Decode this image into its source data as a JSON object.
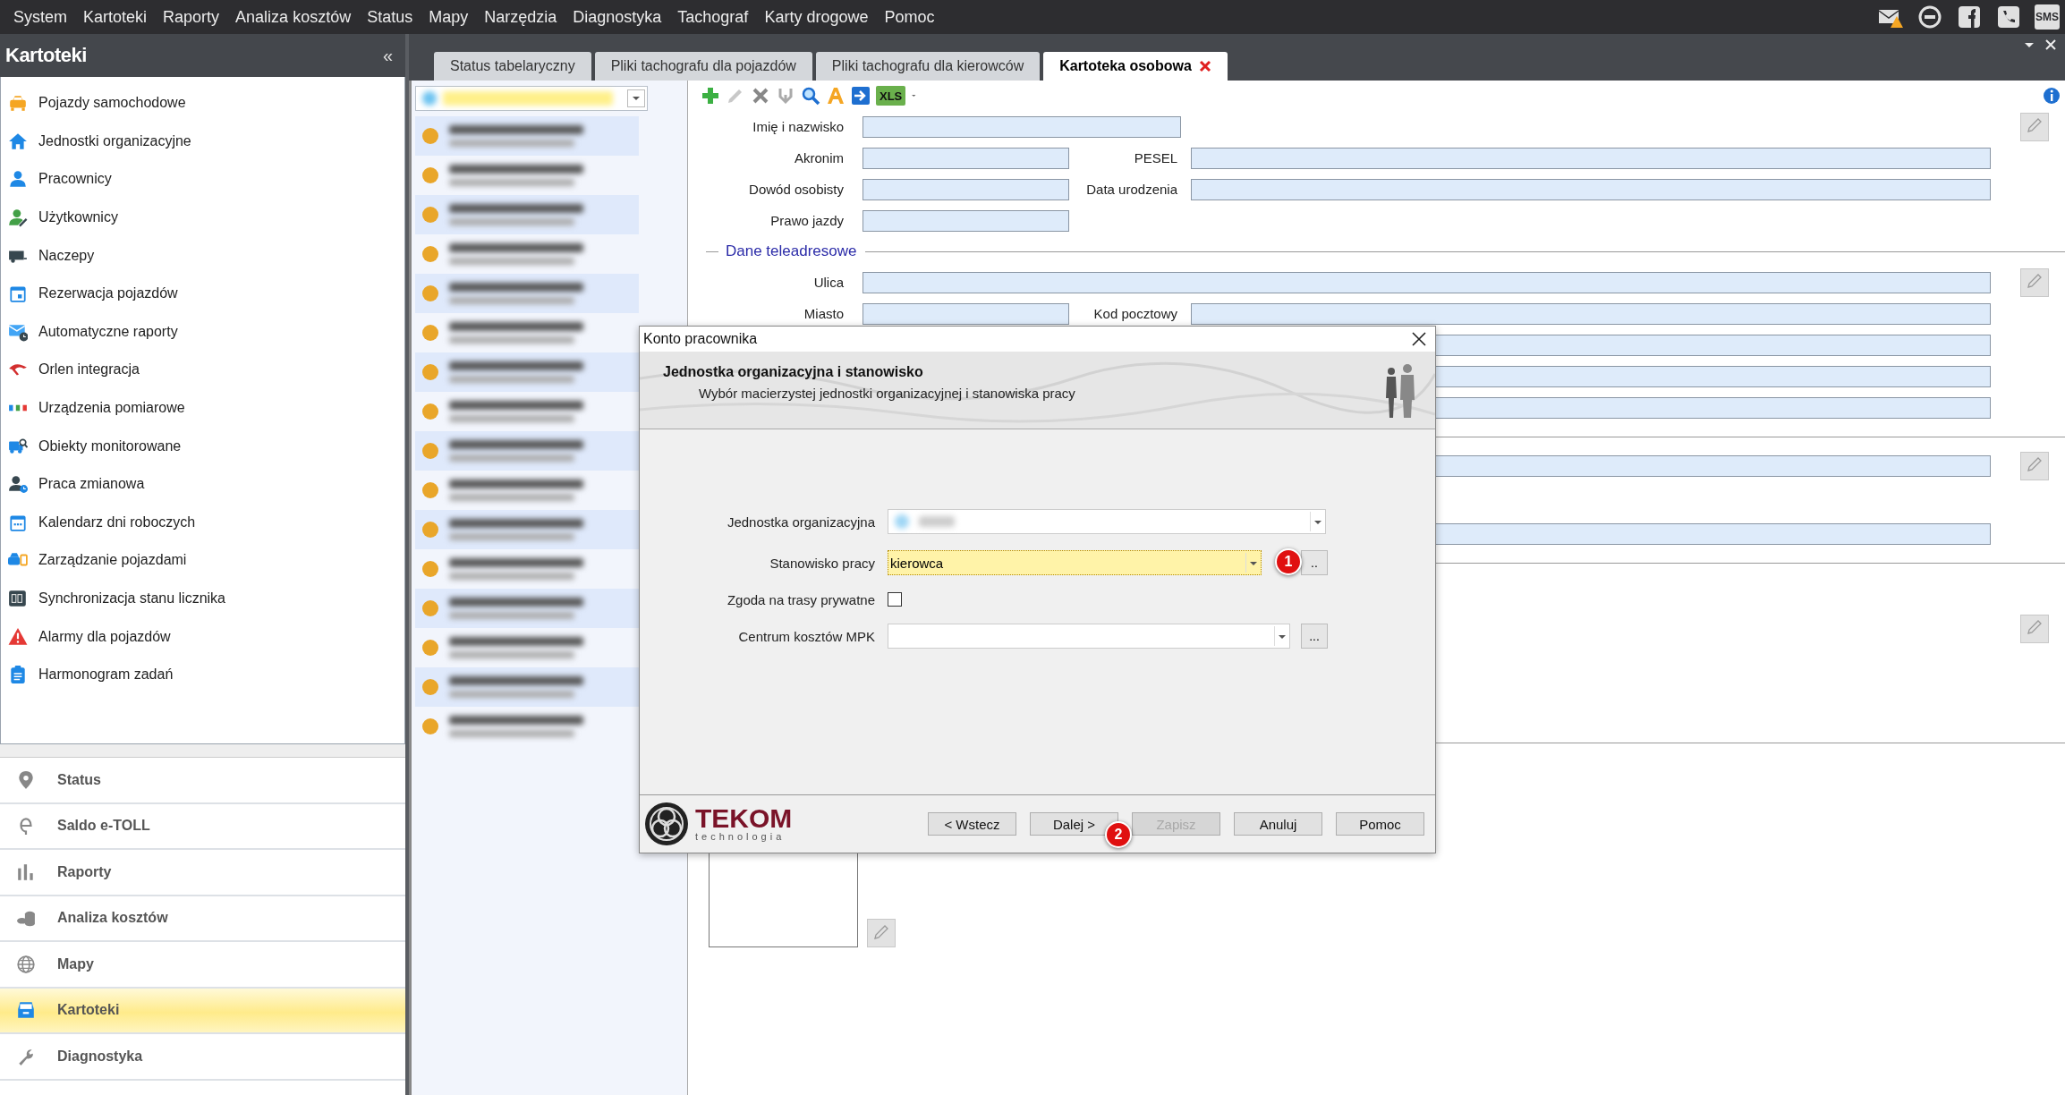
{
  "menu": [
    {
      "label": "System"
    },
    {
      "label": "Kartoteki"
    },
    {
      "label": "Raporty"
    },
    {
      "label": "Analiza kosztów"
    },
    {
      "label": "Status"
    },
    {
      "label": "Mapy"
    },
    {
      "label": "Narzędzia"
    },
    {
      "label": "Diagnostyka"
    },
    {
      "label": "Tachograf"
    },
    {
      "label": "Karty drogowe"
    },
    {
      "label": "Pomoc"
    }
  ],
  "top_icons": {
    "sms": "SMS"
  },
  "sidebar": {
    "title": "Kartoteki",
    "collapse": "«",
    "items": [
      {
        "label": "Pojazdy samochodowe"
      },
      {
        "label": "Jednostki organizacyjne"
      },
      {
        "label": "Pracownicy"
      },
      {
        "label": "Użytkownicy"
      },
      {
        "label": "Naczepy"
      },
      {
        "label": "Rezerwacja pojazdów"
      },
      {
        "label": "Automatyczne raporty"
      },
      {
        "label": "Orlen integracja"
      },
      {
        "label": "Urządzenia pomiarowe"
      },
      {
        "label": "Obiekty monitorowane"
      },
      {
        "label": "Praca zmianowa"
      },
      {
        "label": "Kalendarz dni roboczych"
      },
      {
        "label": "Zarządzanie pojazdami"
      },
      {
        "label": "Synchronizacja stanu licznika"
      },
      {
        "label": "Alarmy dla pojazdów"
      },
      {
        "label": "Harmonogram zadań"
      }
    ],
    "nav": [
      {
        "label": "Status",
        "selected": false
      },
      {
        "label": "Saldo e-TOLL",
        "selected": false
      },
      {
        "label": "Raporty",
        "selected": false
      },
      {
        "label": "Analiza kosztów",
        "selected": false
      },
      {
        "label": "Mapy",
        "selected": false
      },
      {
        "label": "Kartoteki",
        "selected": true
      },
      {
        "label": "Diagnostyka",
        "selected": false
      }
    ]
  },
  "tabs": [
    {
      "label": "Status tabelaryczny",
      "selected": false
    },
    {
      "label": "Pliki tachografu dla pojazdów",
      "selected": false
    },
    {
      "label": "Pliki tachografu dla kierowców",
      "selected": false
    },
    {
      "label": "Kartoteka osobowa",
      "selected": true
    }
  ],
  "list": {
    "rows": [
      {
        "kind": "redacted"
      },
      {
        "kind": "redacted"
      },
      {
        "kind": "redacted"
      },
      {
        "kind": "redacted"
      },
      {
        "kind": "redacted"
      },
      {
        "kind": "redacted"
      },
      {
        "kind": "redacted"
      },
      {
        "kind": "redacted"
      },
      {
        "kind": "redacted"
      },
      {
        "kind": "redacted"
      },
      {
        "kind": "redacted"
      },
      {
        "kind": "redacted"
      },
      {
        "kind": "redacted"
      },
      {
        "kind": "redacted"
      },
      {
        "kind": "redacted"
      },
      {
        "kind": "redacted"
      }
    ]
  },
  "toolbar": {
    "export": "XLS"
  },
  "form": {
    "groups": [
      {
        "rows": [
          {
            "kind": "single-long",
            "label": "Imię i nazwisko",
            "edit_button": true
          },
          {
            "kind": "pair",
            "label": "Akronim",
            "label2": "PESEL",
            "edit_button": false
          },
          {
            "kind": "pair",
            "label": "Dowód osobisty",
            "label2": "Data urodzenia",
            "edit_button": false
          },
          {
            "kind": "single",
            "label": "Prawo jazdy",
            "edit_button": false
          }
        ]
      },
      {
        "section": "Dane teleadresowe",
        "rows": [
          {
            "kind": "wide",
            "label": "Ulica",
            "edit_button": true
          },
          {
            "kind": "pair",
            "label": "Miasto",
            "label2": "Kod pocztowy",
            "edit_button": false
          },
          {
            "kind": "wide",
            "edit_button": false
          },
          {
            "kind": "wide",
            "edit_button": false
          },
          {
            "kind": "wide",
            "edit_button": false
          }
        ]
      },
      {
        "rows": [
          {
            "kind": "wide",
            "edit_button": true
          },
          {
            "kind": "wide",
            "edit_button": false
          }
        ]
      },
      {
        "rows": [
          {
            "kind": "none",
            "edit_button": true
          }
        ]
      },
      {
        "rows": [
          {
            "kind": "photo",
            "edit_button": true
          }
        ]
      }
    ]
  },
  "dialog": {
    "title": "Konto pracownika",
    "heading": "Jednostka organizacyjna i stanowisko",
    "subtitle": "Wybór macierzystej jednostki organizacyjnej i stanowiska pracy",
    "fields": [
      {
        "kind": "combo-redacted",
        "label": "Jednostka organizacyjna"
      },
      {
        "kind": "combo",
        "label": "Stanowisko pracy",
        "value": "kierowca",
        "focused": true,
        "browse": ".."
      },
      {
        "kind": "checkbox",
        "label": "Zgoda na trasy prywatne",
        "checked": false
      },
      {
        "kind": "combo",
        "label": "Centrum kosztów MPK",
        "focused": false,
        "browse": "..."
      }
    ],
    "logo": {
      "name": "TEKOM",
      "tagline": "technologia"
    },
    "buttons": [
      {
        "label": "< Wstecz",
        "disabled": false
      },
      {
        "label": "Dalej >",
        "disabled": false
      },
      {
        "label": "Zapisz",
        "disabled": true
      },
      {
        "label": "Anuluj",
        "disabled": false
      },
      {
        "label": "Pomoc",
        "disabled": false
      }
    ],
    "markers": [
      {
        "label": "1"
      },
      {
        "label": "2"
      }
    ]
  }
}
